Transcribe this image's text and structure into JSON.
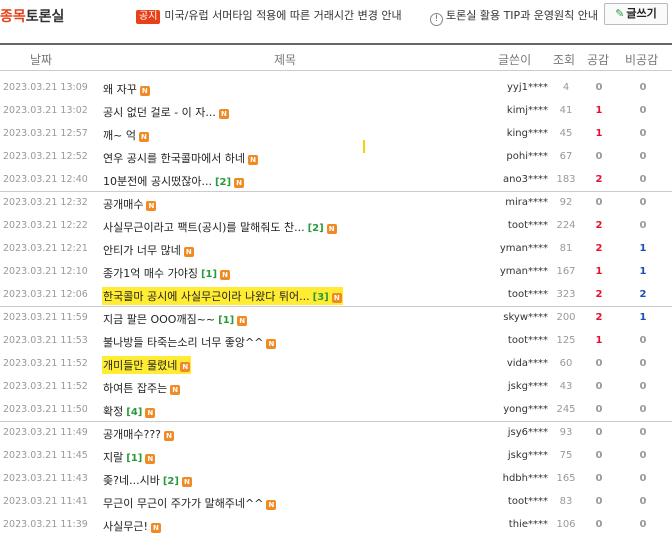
{
  "header": {
    "title_highlight": "종목",
    "title_rest": "토론실",
    "notice_tag": "공지",
    "notice_text": "미국/유럽 서머타임 적용에 따른 거래시간 변경 안내",
    "tip_icon": "!",
    "tip_text": "토론실 활용 TIP과 운영원칙 안내",
    "write_icon": "pencil-icon",
    "write_label": "글쓰기"
  },
  "columns": {
    "date": "날짜",
    "subject": "제목",
    "author": "글쓴이",
    "views": "조회",
    "likes": "공감",
    "dislikes": "비공감"
  },
  "new_badge": "N",
  "rows": [
    {
      "date": "2023.03.21 13:09",
      "title": "왜 자꾸",
      "comments": "",
      "author": "yyj1****",
      "views": "4",
      "likes": "0",
      "dislikes": "0",
      "highlight": false
    },
    {
      "date": "2023.03.21 13:02",
      "title": "공시 없던 걸로 - 이 자...",
      "comments": "",
      "author": "kimj****",
      "views": "41",
      "likes": "1",
      "dislikes": "0",
      "highlight": false
    },
    {
      "date": "2023.03.21 12:57",
      "title": "깨~ 억",
      "comments": "",
      "author": "king****",
      "views": "45",
      "likes": "1",
      "dislikes": "0",
      "highlight": false
    },
    {
      "date": "2023.03.21 12:52",
      "title": "연우 공시를 한국콜마에서 하네",
      "comments": "",
      "author": "pohi****",
      "views": "67",
      "likes": "0",
      "dislikes": "0",
      "highlight": false
    },
    {
      "date": "2023.03.21 12:40",
      "title": "10분전에 공시떴잖아...",
      "comments": "[2]",
      "author": "ano3****",
      "views": "183",
      "likes": "2",
      "dislikes": "0",
      "highlight": false
    },
    {
      "date": "2023.03.21 12:32",
      "title": "공개매수",
      "comments": "",
      "author": "mira****",
      "views": "92",
      "likes": "0",
      "dislikes": "0",
      "highlight": false
    },
    {
      "date": "2023.03.21 12:22",
      "title": "사실무근이라고 팩트(공시)를 말해줘도 찬...",
      "comments": "[2]",
      "author": "toot****",
      "views": "224",
      "likes": "2",
      "dislikes": "0",
      "highlight": false
    },
    {
      "date": "2023.03.21 12:21",
      "title": "안티가 너무 많네",
      "comments": "",
      "author": "yman****",
      "views": "81",
      "likes": "2",
      "dislikes": "1",
      "highlight": false
    },
    {
      "date": "2023.03.21 12:10",
      "title": "종가1억 매수 가야징",
      "comments": "[1]",
      "author": "yman****",
      "views": "167",
      "likes": "1",
      "dislikes": "1",
      "highlight": false
    },
    {
      "date": "2023.03.21 12:06",
      "title": "한국콜마 공시에 사실무근이라 나왔다 튀어...",
      "comments": "[3]",
      "author": "toot****",
      "views": "323",
      "likes": "2",
      "dislikes": "2",
      "highlight": true
    },
    {
      "date": "2023.03.21 11:59",
      "title": "지금 팔믄 OOO깨짐~~",
      "comments": "[1]",
      "author": "skyw****",
      "views": "200",
      "likes": "2",
      "dislikes": "1",
      "highlight": false
    },
    {
      "date": "2023.03.21 11:53",
      "title": "불나방들 타죽는소리 너무 좋앙^^",
      "comments": "",
      "author": "toot****",
      "views": "125",
      "likes": "1",
      "dislikes": "0",
      "highlight": false
    },
    {
      "date": "2023.03.21 11:52",
      "title": "개미들만 물렸네",
      "comments": "",
      "author": "vida****",
      "views": "60",
      "likes": "0",
      "dislikes": "0",
      "highlight": true
    },
    {
      "date": "2023.03.21 11:52",
      "title": "하여튼 잡주는",
      "comments": "",
      "author": "jskg****",
      "views": "43",
      "likes": "0",
      "dislikes": "0",
      "highlight": false
    },
    {
      "date": "2023.03.21 11:50",
      "title": "확정",
      "comments": "[4]",
      "author": "yong****",
      "views": "245",
      "likes": "0",
      "dislikes": "0",
      "highlight": false
    },
    {
      "date": "2023.03.21 11:49",
      "title": "공개매수???",
      "comments": "",
      "author": "jsy6****",
      "views": "93",
      "likes": "0",
      "dislikes": "0",
      "highlight": false
    },
    {
      "date": "2023.03.21 11:45",
      "title": "지랄",
      "comments": "[1]",
      "author": "jskg****",
      "views": "75",
      "likes": "0",
      "dislikes": "0",
      "highlight": false
    },
    {
      "date": "2023.03.21 11:43",
      "title": "좆?네...시바",
      "comments": "[2]",
      "author": "hdbh****",
      "views": "165",
      "likes": "0",
      "dislikes": "0",
      "highlight": false
    },
    {
      "date": "2023.03.21 11:41",
      "title": "무근이 무근이 주가가 말해주네^^",
      "comments": "",
      "author": "toot****",
      "views": "83",
      "likes": "0",
      "dislikes": "0",
      "highlight": false
    },
    {
      "date": "2023.03.21 11:39",
      "title": "사실무근!",
      "comments": "",
      "author": "thie****",
      "views": "106",
      "likes": "0",
      "dislikes": "0",
      "highlight": false
    }
  ],
  "colors": {
    "accent": "#e8411a",
    "highlight": "#ffec33",
    "new_badge": "#f08a24",
    "likes": "#e8112d",
    "dislikes": "#1a4fb8",
    "comments": "#2a9a3c"
  }
}
